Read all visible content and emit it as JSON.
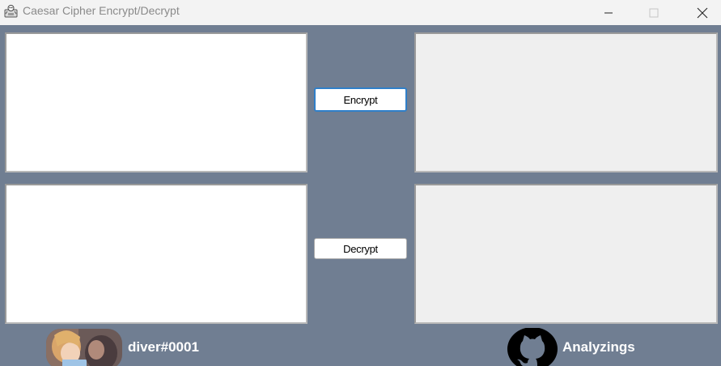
{
  "window": {
    "title": "Caesar Cipher Encrypt/Decrypt",
    "app_icon": "app-icon",
    "controls": {
      "minimize_icon": "minimize-icon",
      "maximize_icon": "maximize-icon",
      "close_icon": "close-icon"
    }
  },
  "encrypt_section": {
    "input_value": "",
    "output_value": "",
    "button_label": "Encrypt"
  },
  "decrypt_section": {
    "input_value": "",
    "output_value": "",
    "button_label": "Decrypt"
  },
  "footer": {
    "avatar_icon": "avatar-image",
    "username": "diver#0001",
    "github_icon": "github-icon",
    "github_name": "Analyzings"
  },
  "colors": {
    "background": "#707e92",
    "titlebar": "#f3f3f3",
    "accent_border": "#2f7fc9",
    "output_box": "#efefef"
  }
}
